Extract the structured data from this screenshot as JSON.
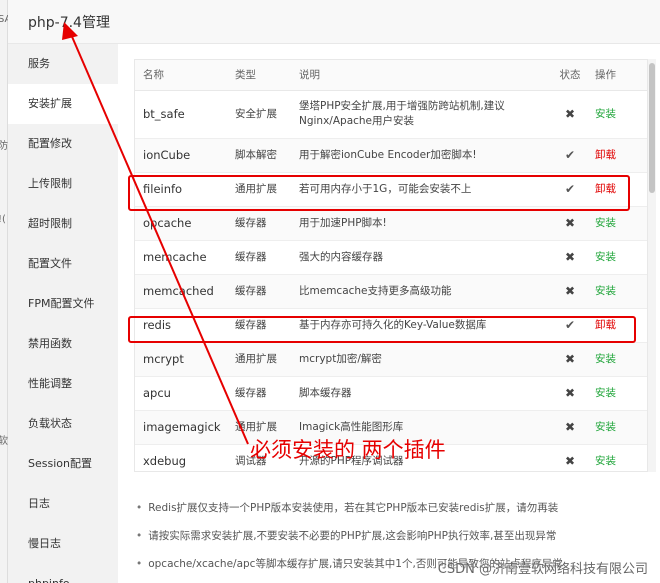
{
  "left_strip": {
    "fragments": [
      "SA",
      "防",
      "!(",
      "软"
    ]
  },
  "dialog": {
    "title": "php-7.4管理"
  },
  "sidebar": {
    "items": [
      {
        "label": "服务"
      },
      {
        "label": "安装扩展",
        "active": true
      },
      {
        "label": "配置修改"
      },
      {
        "label": "上传限制"
      },
      {
        "label": "超时限制"
      },
      {
        "label": "配置文件"
      },
      {
        "label": "FPM配置文件"
      },
      {
        "label": "禁用函数"
      },
      {
        "label": "性能调整"
      },
      {
        "label": "负载状态"
      },
      {
        "label": "Session配置"
      },
      {
        "label": "日志"
      },
      {
        "label": "慢日志"
      },
      {
        "label": "phpinfo"
      }
    ]
  },
  "table": {
    "headers": [
      "名称",
      "类型",
      "说明",
      "状态",
      "操作"
    ],
    "rows": [
      {
        "name": "bt_safe",
        "type": "安全扩展",
        "desc": "堡塔PHP安全扩展,用于增强防跨站机制,建议Nginx/Apache用户安装",
        "installed": false,
        "action": "安装"
      },
      {
        "name": "ionCube",
        "type": "脚本解密",
        "desc": "用于解密ionCube Encoder加密脚本!",
        "installed": true,
        "action": "卸载"
      },
      {
        "name": "fileinfo",
        "type": "通用扩展",
        "desc": "若可用内存小于1G，可能会安装不上",
        "installed": true,
        "action": "卸载"
      },
      {
        "name": "opcache",
        "type": "缓存器",
        "desc": "用于加速PHP脚本!",
        "installed": false,
        "action": "安装"
      },
      {
        "name": "memcache",
        "type": "缓存器",
        "desc": "强大的内容缓存器",
        "installed": false,
        "action": "安装"
      },
      {
        "name": "memcached",
        "type": "缓存器",
        "desc": "比memcache支持更多高级功能",
        "installed": false,
        "action": "安装"
      },
      {
        "name": "redis",
        "type": "缓存器",
        "desc": "基于内存亦可持久化的Key-Value数据库",
        "installed": true,
        "action": "卸载"
      },
      {
        "name": "mcrypt",
        "type": "通用扩展",
        "desc": "mcrypt加密/解密",
        "installed": false,
        "action": "安装"
      },
      {
        "name": "apcu",
        "type": "缓存器",
        "desc": "脚本缓存器",
        "installed": false,
        "action": "安装"
      },
      {
        "name": "imagemagick",
        "type": "通用扩展",
        "desc": "Imagick高性能图形库",
        "installed": false,
        "action": "安装"
      },
      {
        "name": "xdebug",
        "type": "调试器",
        "desc": "开源的PHP程序调试器",
        "installed": false,
        "action": "安装"
      }
    ],
    "status_icons": {
      "installed": "check-icon",
      "not_installed": "cross-icon"
    }
  },
  "notes": [
    "Redis扩展仅支持一个PHP版本安装使用，若在其它PHP版本已安装redis扩展，请勿再装",
    "请按实际需求安装扩展,不要安装不必要的PHP扩展,这会影响PHP执行效率,甚至出现异常",
    "opcache/xcache/apc等脚本缓存扩展,请只安装其中1个,否则可能导致您的站点程序异常"
  ],
  "annotation": {
    "text": "必须安装的 两个插件",
    "color": "#e60000"
  },
  "watermark": "CSDN @济南壹软网络科技有限公司",
  "colors": {
    "install": "#20a53a",
    "uninstall": "#e00000",
    "annotation": "#e60000"
  }
}
